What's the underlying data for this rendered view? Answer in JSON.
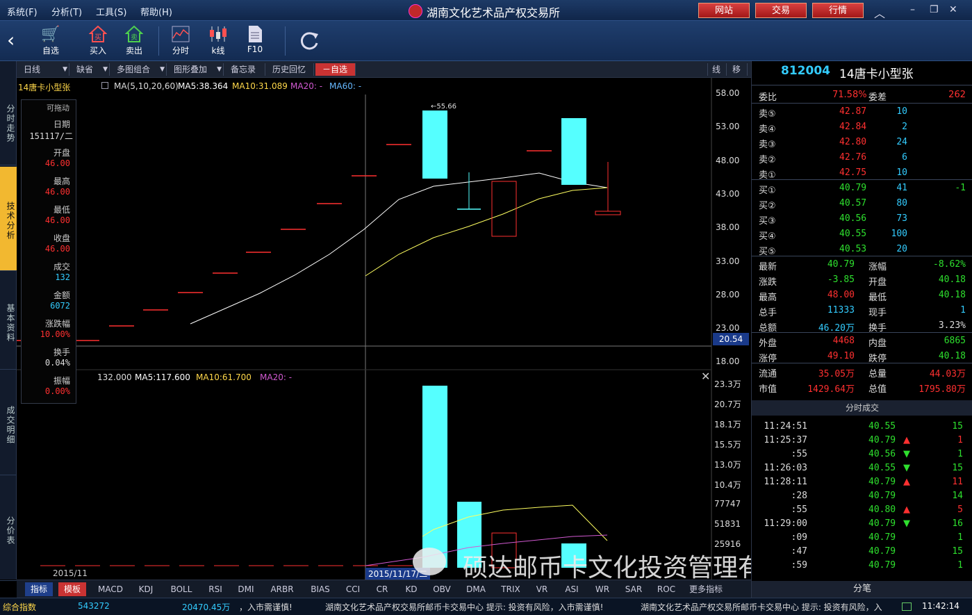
{
  "menu": {
    "items": [
      "系统(F)",
      "分析(T)",
      "工具(S)",
      "帮助(H)"
    ],
    "title": "湖南文化艺术品产权交易所",
    "buttons": [
      "网站",
      "交易",
      "行情"
    ]
  },
  "toolbar": {
    "items": [
      {
        "label": "自选",
        "icon": "cart-icon"
      },
      {
        "label": "买入",
        "icon": "buy-icon"
      },
      {
        "label": "卖出",
        "icon": "sell-icon"
      },
      {
        "label": "分时",
        "icon": "timeshare-icon"
      },
      {
        "label": "k线",
        "icon": "kline-icon"
      },
      {
        "label": "F10",
        "icon": "doc-icon"
      }
    ]
  },
  "lefttabs": [
    "分时走势",
    "技术分析",
    "基本资料",
    "成交明细",
    "分价表"
  ],
  "charttool": {
    "items": [
      "日线",
      "缺省",
      "多图组合",
      "图形叠加",
      "备忘录",
      "历史回忆",
      "自选"
    ],
    "right": [
      "线",
      "移"
    ]
  },
  "chart": {
    "stock_name": "14唐卡小型张",
    "ma_label": "MA(5,10,20,60)",
    "ma5": "MA5:38.364",
    "ma10": "MA10:31.089",
    "ma20": "MA20: -",
    "ma60": "MA60: -",
    "price_axis": [
      "58.00",
      "53.00",
      "48.00",
      "43.00",
      "38.00",
      "33.00",
      "28.00",
      "23.00",
      "18.00"
    ],
    "cursor_price": "20.54",
    "high_mark": "55.66",
    "vol_value": "132.000",
    "vma5": "MA5:117.600",
    "vma10": "MA10:61.700",
    "vma20": "MA20: -",
    "vol_axis": [
      "23.3万",
      "20.7万",
      "18.1万",
      "15.5万",
      "13.0万",
      "10.4万",
      "77747",
      "51831",
      "25916"
    ],
    "date_left": "2015/11",
    "date_cursor": "2015/11/17/二"
  },
  "info": {
    "draggable": "可拖动",
    "fields": [
      {
        "label": "日期",
        "value": "151117/二"
      },
      {
        "label": "开盘",
        "value": "46.00"
      },
      {
        "label": "最高",
        "value": "46.00"
      },
      {
        "label": "最低",
        "value": "46.00"
      },
      {
        "label": "收盘",
        "value": "46.00"
      },
      {
        "label": "成交",
        "value": "132"
      },
      {
        "label": "金额",
        "value": "6072"
      },
      {
        "label": "涨跌幅",
        "value": "10.00%"
      },
      {
        "label": "换手",
        "value": "0.04%"
      },
      {
        "label": "振幅",
        "value": "0.00%"
      }
    ]
  },
  "itabs": [
    "指标",
    "模板",
    "MACD",
    "KDJ",
    "BOLL",
    "RSI",
    "DMI",
    "ARBR",
    "BIAS",
    "CCI",
    "CR",
    "KD",
    "OBV",
    "DMA",
    "TRIX",
    "VR",
    "ASI",
    "WR",
    "SAR",
    "ROC",
    "更多指标"
  ],
  "quote": {
    "code": "812004",
    "name": "14唐卡小型张",
    "weibi_label": "委比",
    "weibi": "71.58%",
    "weicha_label": "委差",
    "weicha": "262",
    "sells": [
      {
        "l": "卖⑤",
        "p": "42.87",
        "v": "10"
      },
      {
        "l": "卖④",
        "p": "42.84",
        "v": "2"
      },
      {
        "l": "卖③",
        "p": "42.80",
        "v": "24"
      },
      {
        "l": "卖②",
        "p": "42.76",
        "v": "6"
      },
      {
        "l": "卖①",
        "p": "42.75",
        "v": "10"
      }
    ],
    "buys": [
      {
        "l": "买①",
        "p": "40.79",
        "v": "41",
        "d": "-1"
      },
      {
        "l": "买②",
        "p": "40.57",
        "v": "80",
        "d": ""
      },
      {
        "l": "买③",
        "p": "40.56",
        "v": "73",
        "d": ""
      },
      {
        "l": "买④",
        "p": "40.55",
        "v": "100",
        "d": ""
      },
      {
        "l": "买⑤",
        "p": "40.53",
        "v": "20",
        "d": ""
      }
    ],
    "stats": [
      [
        "最新",
        "40.79",
        "涨幅",
        "-8.62%"
      ],
      [
        "涨跌",
        "-3.85",
        "开盘",
        "40.18"
      ],
      [
        "最高",
        "48.00",
        "最低",
        "40.18"
      ],
      [
        "总手",
        "11333",
        "现手",
        "1"
      ],
      [
        "总额",
        "46.20万",
        "换手",
        "3.23%"
      ],
      [
        "外盘",
        "4468",
        "内盘",
        "6865"
      ],
      [
        "涨停",
        "49.10",
        "跌停",
        "40.18"
      ],
      [
        "流通",
        "35.05万",
        "总量",
        "44.03万"
      ],
      [
        "市值",
        "1429.64万",
        "总值",
        "1795.80万"
      ]
    ],
    "ticks_title": "分时成交",
    "ticks": [
      [
        "11:24:51",
        "40.55",
        "",
        "15"
      ],
      [
        "11:25:37",
        "40.79",
        "▲",
        "1"
      ],
      [
        ":55",
        "40.56",
        "▼",
        "1"
      ],
      [
        "11:26:03",
        "40.55",
        "▼",
        "15"
      ],
      [
        "11:28:11",
        "40.79",
        "▲",
        "11"
      ],
      [
        ":28",
        "40.79",
        "",
        "14"
      ],
      [
        ":55",
        "40.80",
        "▲",
        "5"
      ],
      [
        "11:29:00",
        "40.79",
        "▼",
        "16"
      ],
      [
        ":09",
        "40.79",
        "",
        "1"
      ],
      [
        ":47",
        "40.79",
        "",
        "15"
      ],
      [
        ":59",
        "40.79",
        "",
        "1"
      ]
    ],
    "tab": "分笔"
  },
  "status": {
    "index_label": "综合指数",
    "index_value": "543272",
    "amount": "20470.45万",
    "ticker1": "，入市需谨慎!",
    "ticker2": "湖南文化艺术品产权交易所邮币卡交易中心  提示:  投资有风险，入市需谨慎!",
    "ticker3": "湖南文化艺术品产权交易所邮币卡交易中心  提示:  投资有风险，入",
    "time": "11:42:14"
  },
  "watermark": "硕达邮币卡文化投资管理有限公司"
}
